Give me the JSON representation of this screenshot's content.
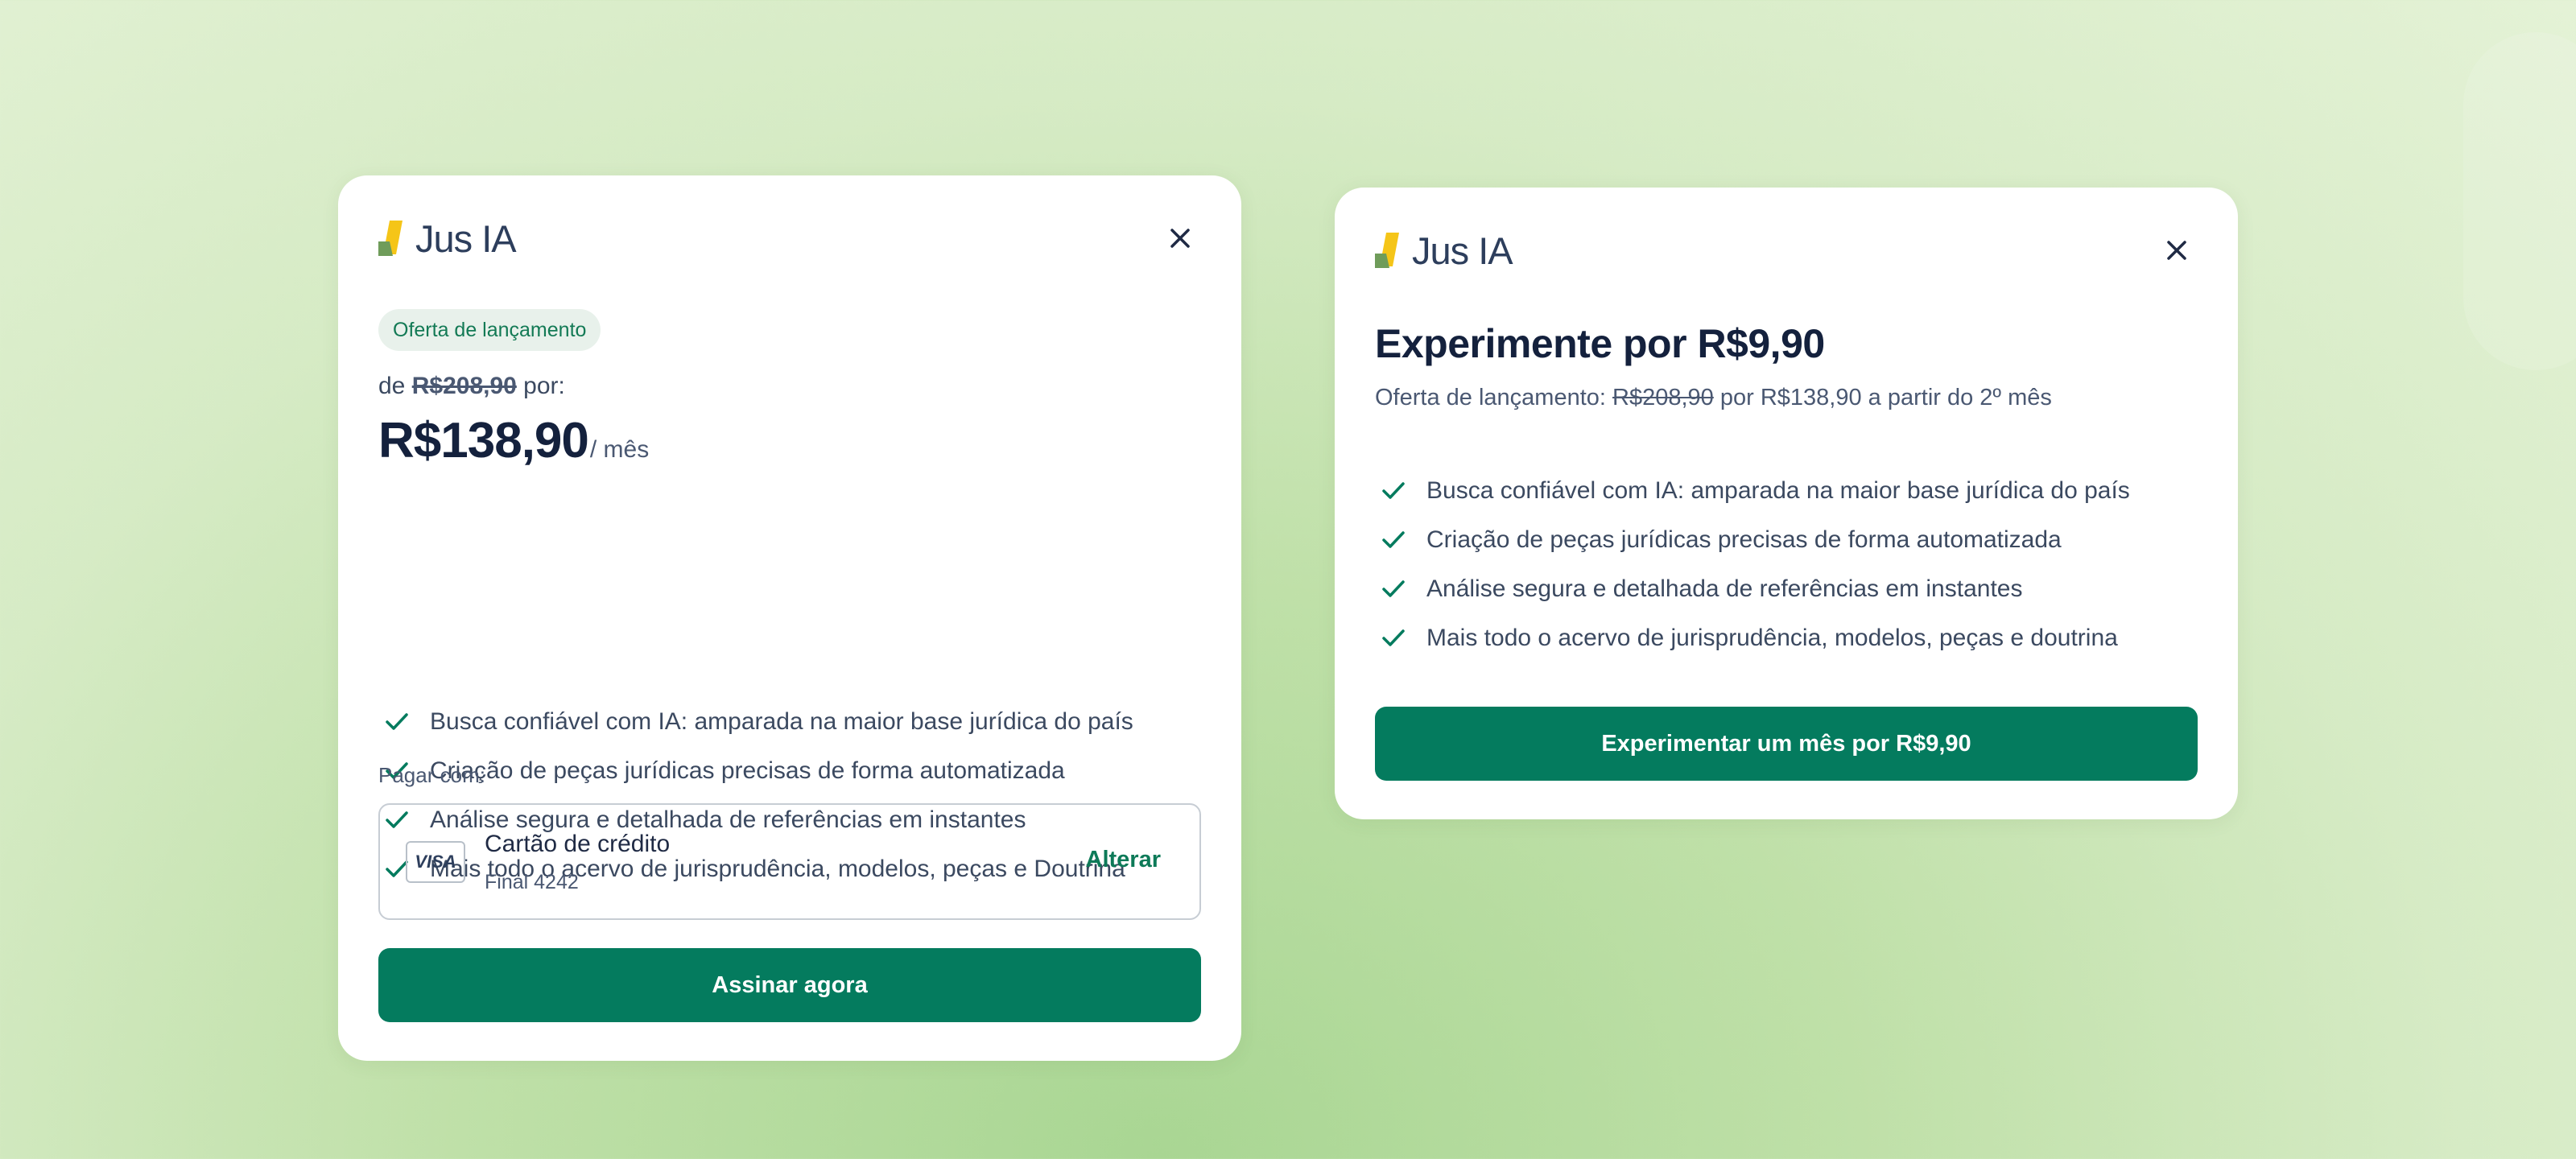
{
  "colors": {
    "accent": "#047b5e",
    "logo_yellow": "#f5c518",
    "logo_green": "#6f9c5a"
  },
  "card_monthly": {
    "logo": {
      "text": "Jus IA"
    },
    "close_icon": "close-icon",
    "badge": "Oferta de lançamento",
    "from_prefix": "de",
    "old_price": "R$208,90",
    "from_suffix": "por:",
    "price": "R$138,90",
    "period": "/ mês",
    "features": [
      "Busca confiável com IA: amparada na maior base jurídica do país",
      "Criação de peças jurídicas precisas de forma automatizada",
      "Análise segura e detalhada de referências em instantes",
      "Mais todo o acervo de jurisprudência, modelos, peças e Doutrina"
    ],
    "payment": {
      "label": "Pagar com:",
      "card_brand": "VISA",
      "method": "Cartão de crédito",
      "last_digits": "Final 4242",
      "change_label": "Alterar"
    },
    "cta": "Assinar agora"
  },
  "card_trial": {
    "logo": {
      "text": "Jus IA"
    },
    "close_icon": "close-icon",
    "title": "Experimente por R$9,90",
    "subtitle_prefix": "Oferta de lançamento:",
    "old_price": "R$208,90",
    "subtitle_suffix": "por R$138,90 a partir do 2º mês",
    "features": [
      "Busca confiável com IA: amparada na maior base jurídica do país",
      "Criação de peças jurídicas precisas de forma automatizada",
      "Análise segura e detalhada de referências em instantes",
      "Mais todo o acervo de jurisprudência, modelos, peças e doutrina"
    ],
    "cta": "Experimentar um mês por R$9,90"
  }
}
